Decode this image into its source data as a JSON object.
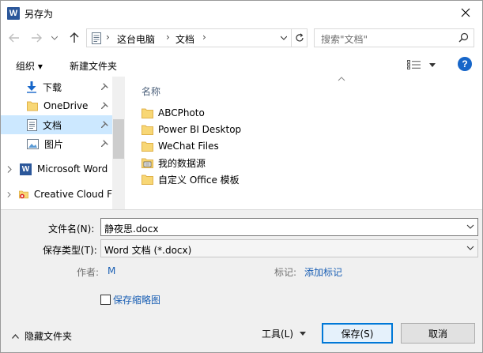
{
  "window": {
    "title": "另存为",
    "app_icon": "word-icon"
  },
  "address": {
    "segments": [
      "这台电脑",
      "文档"
    ],
    "search_placeholder": "搜索\"文档\""
  },
  "toolbar": {
    "organize": "组织 ▾",
    "new_folder": "新建文件夹",
    "help": "?"
  },
  "nav": {
    "items": [
      {
        "label": "下载",
        "icon": "download-icon",
        "pinned": true
      },
      {
        "label": "OneDrive",
        "icon": "folder-icon",
        "pinned": true
      },
      {
        "label": "文档",
        "icon": "document-icon",
        "pinned": true,
        "selected": true
      },
      {
        "label": "图片",
        "icon": "picture-icon",
        "pinned": true
      },
      {
        "label": "Microsoft Word",
        "icon": "word-icon",
        "expandable": true
      },
      {
        "label": "Creative Cloud F",
        "icon": "creative-cloud-icon",
        "expandable": true
      }
    ]
  },
  "files": {
    "column_header": "名称",
    "items": [
      {
        "name": "ABCPhoto",
        "icon": "folder-icon"
      },
      {
        "name": "Power BI Desktop",
        "icon": "folder-icon"
      },
      {
        "name": "WeChat Files",
        "icon": "folder-icon"
      },
      {
        "name": "我的数据源",
        "icon": "data-source-folder-icon"
      },
      {
        "name": "自定义 Office 模板",
        "icon": "folder-icon"
      }
    ]
  },
  "form": {
    "filename_label": "文件名(N):",
    "filename_value": "静夜思.docx",
    "filetype_label": "保存类型(T):",
    "filetype_value": "Word 文档 (*.docx)",
    "author_label": "作者:",
    "author_value": "M",
    "tags_label": "标记:",
    "tags_value": "添加标记",
    "thumbnail_label": "保存缩略图",
    "thumbnail_checked": false
  },
  "footer": {
    "hide_folders": "隐藏文件夹",
    "tools": "工具(L)",
    "save": "保存(S)",
    "cancel": "取消"
  },
  "colors": {
    "accent": "#0078d7",
    "selected_bg": "#cce8ff",
    "link": "#1a5fb4",
    "folder": "#f8d775"
  }
}
